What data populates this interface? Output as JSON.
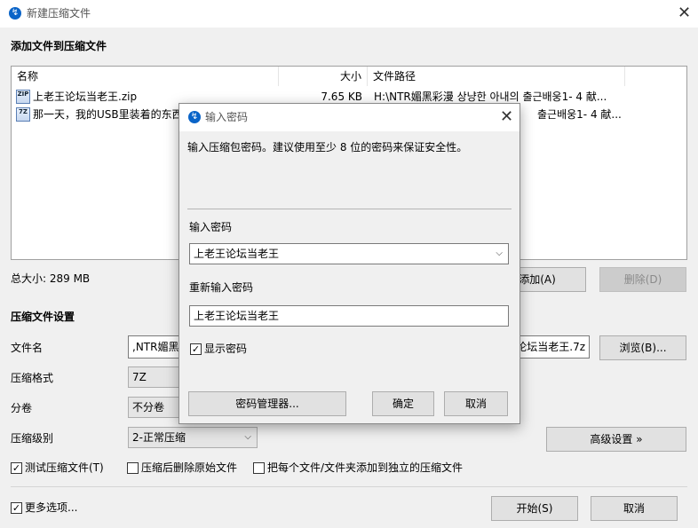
{
  "window": {
    "title": "新建压缩文件",
    "add_section_title": "添加文件到压缩文件",
    "columns": [
      "名称",
      "大小",
      "文件路径"
    ],
    "files": [
      {
        "icon": "zip-file-icon",
        "icon_text": "ZIP",
        "name": "上老王论坛当老王.zip",
        "size": "7.65 KB",
        "path": "H:\\NTR媚黑彩漫 상냥한 아내의 출근배웅1- 4 献..."
      },
      {
        "icon": "7z-file-icon",
        "icon_text": "7Z",
        "name": "那一天，我的USB里装着的东西",
        "size": "",
        "path": "출근배웅1- 4 献..."
      }
    ],
    "total_size": "总大小: 289 MB",
    "add_button": "添加(A)",
    "delete_button": "删除(D)",
    "settings_section_title": "压缩文件设置",
    "filename_label": "文件名",
    "filename_value_left": ",NTR媚黑彩",
    "filename_value_right": "论坛当老王.7z",
    "browse_button": "浏览(B)...",
    "format_label": "压缩格式",
    "format_value": "7Z",
    "volume_label": "分卷",
    "volume_value": "不分卷",
    "level_label": "压缩级别",
    "level_value": "2-正常压缩",
    "advanced_button": "高级设置 »",
    "test_checkbox": "测试压缩文件(T)",
    "delete_after_checkbox": "压缩后删除原始文件",
    "separate_checkbox": "把每个文件/文件夹添加到独立的压缩文件",
    "more_options_checkbox": "更多选项...",
    "start_button": "开始(S)",
    "cancel_button": "取消"
  },
  "dialog": {
    "title": "输入密码",
    "description": "输入压缩包密码。建议使用至少 8 位的密码来保证安全性。",
    "password_label": "输入密码",
    "password_value": "上老王论坛当老王",
    "confirm_label": "重新输入密码",
    "confirm_value": "上老王论坛当老王",
    "show_password_checkbox": "显示密码",
    "manager_button": "密码管理器...",
    "ok_button": "确定",
    "cancel_button": "取消"
  },
  "colors": {
    "accent": "#0078d7",
    "app_icon": "#0a64c8"
  }
}
